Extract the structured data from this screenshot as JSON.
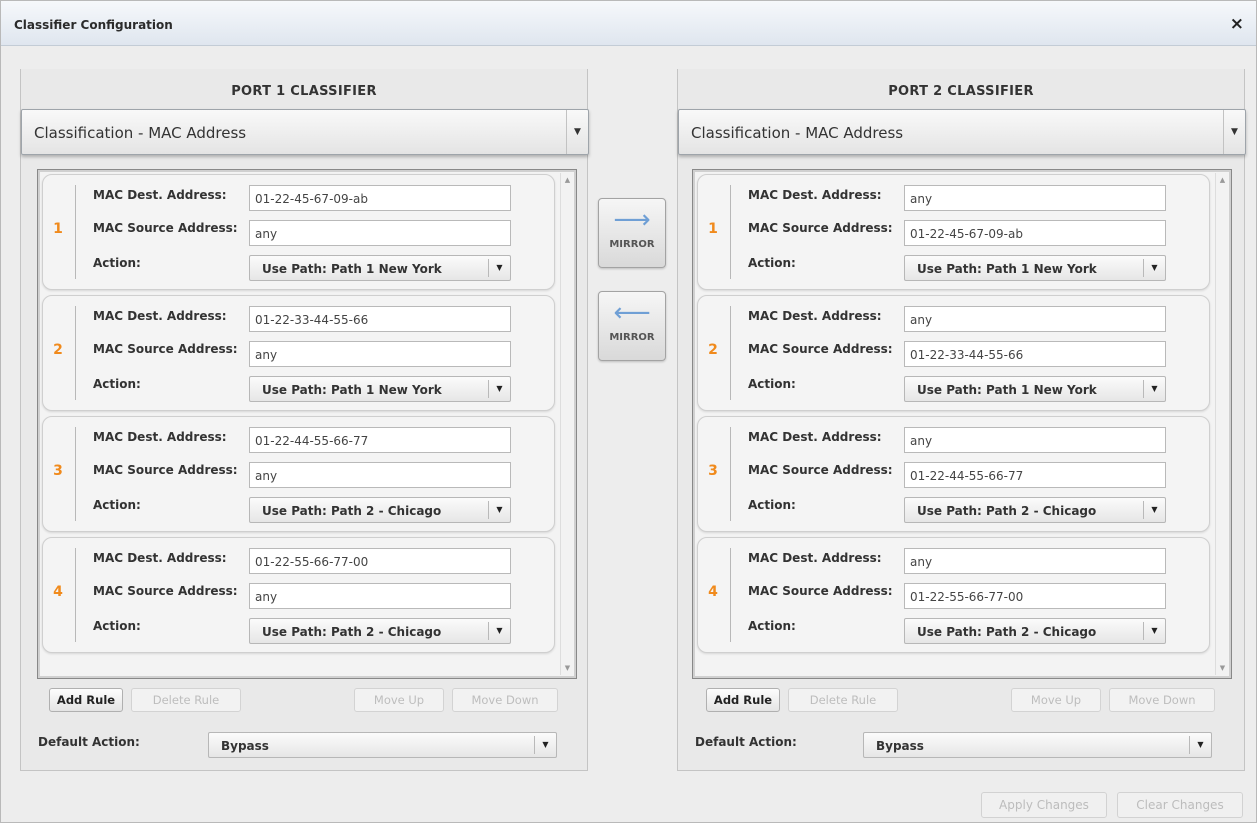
{
  "window": {
    "title": "Classifier Configuration",
    "close_glyph": "×"
  },
  "mirror": {
    "right_label": "MIRROR",
    "left_label": "MIRROR",
    "right_arrow": "⟶",
    "left_arrow": "⟵"
  },
  "ports": [
    {
      "heading": "PORT 1 CLASSIFIER",
      "classification": "Classification - MAC Address",
      "labels": {
        "dest": "MAC Dest. Address:",
        "src": "MAC Source Address:",
        "action": "Action:"
      },
      "rules": [
        {
          "num": "1",
          "dest": "01-22-45-67-09-ab",
          "src": "any",
          "action": "Use Path: Path 1 New York"
        },
        {
          "num": "2",
          "dest": "01-22-33-44-55-66",
          "src": "any",
          "action": "Use Path: Path 1 New York"
        },
        {
          "num": "3",
          "dest": "01-22-44-55-66-77",
          "src": "any",
          "action": "Use Path: Path 2 - Chicago"
        },
        {
          "num": "4",
          "dest": "01-22-55-66-77-00",
          "src": "any",
          "action": "Use Path: Path 2 - Chicago"
        }
      ],
      "buttons": {
        "add": "Add Rule",
        "delete": "Delete Rule",
        "up": "Move Up",
        "down": "Move Down"
      },
      "default_label": "Default Action:",
      "default_value": "Bypass"
    },
    {
      "heading": "PORT 2 CLASSIFIER",
      "classification": "Classification - MAC Address",
      "labels": {
        "dest": "MAC Dest. Address:",
        "src": "MAC Source Address:",
        "action": "Action:"
      },
      "rules": [
        {
          "num": "1",
          "dest": "any",
          "src": "01-22-45-67-09-ab",
          "action": "Use Path: Path 1 New York"
        },
        {
          "num": "2",
          "dest": "any",
          "src": "01-22-33-44-55-66",
          "action": "Use Path: Path 1 New York"
        },
        {
          "num": "3",
          "dest": "any",
          "src": "01-22-44-55-66-77",
          "action": "Use Path: Path 2 - Chicago"
        },
        {
          "num": "4",
          "dest": "any",
          "src": "01-22-55-66-77-00",
          "action": "Use Path: Path 2 - Chicago"
        }
      ],
      "buttons": {
        "add": "Add Rule",
        "delete": "Delete Rule",
        "up": "Move Up",
        "down": "Move Down"
      },
      "default_label": "Default Action:",
      "default_value": "Bypass"
    }
  ],
  "footer": {
    "apply": "Apply Changes",
    "clear": "Clear Changes"
  },
  "icons": {
    "dropdown": "chevron-down-icon",
    "scroll_up": "scroll-up-icon",
    "scroll_down": "scroll-down-icon",
    "close": "close-icon"
  },
  "colors": {
    "rule_number": "#f08a1c",
    "mirror_arrow": "#6f9fd5"
  }
}
